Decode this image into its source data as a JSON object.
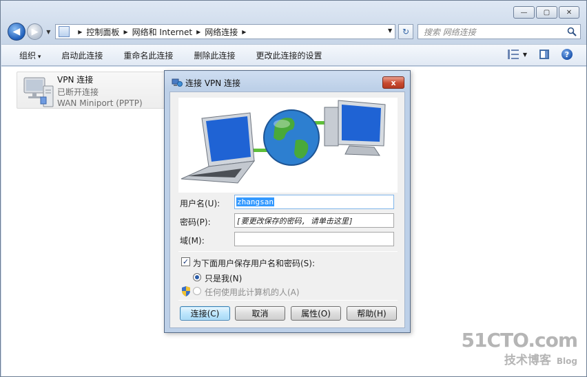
{
  "window": {
    "caption_buttons": {
      "minimize": "—",
      "maximize": "▢",
      "close": "✕"
    }
  },
  "address_bar": {
    "crumbs": [
      "控制面板",
      "网络和 Internet",
      "网络连接"
    ],
    "search_placeholder": "搜索 网络连接"
  },
  "command_bar": {
    "organize": "组织",
    "items": [
      "启动此连接",
      "重命名此连接",
      "删除此连接",
      "更改此连接的设置"
    ]
  },
  "connection": {
    "name": "VPN 连接",
    "status": "已断开连接",
    "device": "WAN Miniport (PPTP)"
  },
  "dialog": {
    "title": "连接 VPN 连接",
    "close_label": "x",
    "username_label": "用户名(U):",
    "username_value": "zhangsan",
    "password_label": "密码(P):",
    "password_value": "[要更改保存的密码, 请单击这里]",
    "domain_label": "域(M):",
    "domain_value": "",
    "save_label": "为下面用户保存用户名和密码(S):",
    "save_checked": true,
    "only_me_label": "只是我(N)",
    "anyone_label": "任何使用此计算机的人(A)",
    "buttons": {
      "connect": "连接(C)",
      "cancel": "取消",
      "properties": "属性(O)",
      "help": "帮助(H)"
    }
  },
  "watermark": {
    "top": "51CTO.com",
    "bottom": "技术博客",
    "blog": "Blog"
  }
}
